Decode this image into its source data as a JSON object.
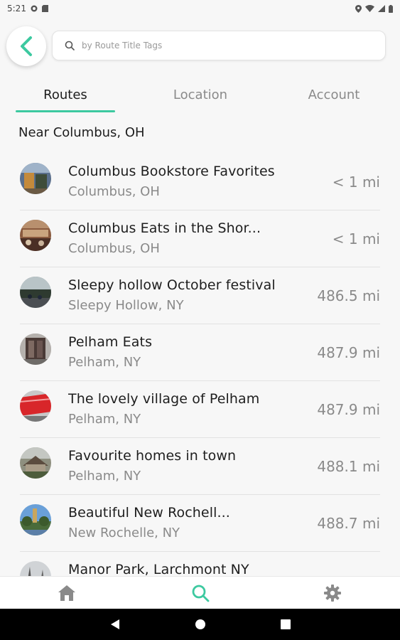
{
  "status_bar": {
    "time": "5:21"
  },
  "search": {
    "placeholder": "by Route Title Tags"
  },
  "tabs": [
    {
      "label": "Routes"
    },
    {
      "label": "Location"
    },
    {
      "label": "Account"
    }
  ],
  "section": {
    "title": "Near Columbus, OH"
  },
  "routes": [
    {
      "title": "Columbus Bookstore Favorites",
      "location": "Columbus, OH",
      "distance": "< 1 mi"
    },
    {
      "title": "Columbus Eats in the Shor...",
      "location": "Columbus, OH",
      "distance": "< 1 mi"
    },
    {
      "title": "Sleepy hollow October festival",
      "location": "Sleepy Hollow, NY",
      "distance": "486.5 mi"
    },
    {
      "title": "Pelham Eats",
      "location": "Pelham, NY",
      "distance": "487.9 mi"
    },
    {
      "title": "The lovely village of Pelham",
      "location": "Pelham, NY",
      "distance": "487.9 mi"
    },
    {
      "title": "Favourite homes in town",
      "location": "Pelham, NY",
      "distance": "488.1 mi"
    },
    {
      "title": "Beautiful New Rochell...",
      "location": "New Rochelle, NY",
      "distance": "488.7 mi"
    },
    {
      "title": "Manor Park, Larchmont NY",
      "location": "",
      "distance": ""
    }
  ],
  "colors": {
    "accent": "#3dc9a0",
    "muted_text": "#8a8a8a",
    "primary_text": "#1e1e1e"
  },
  "icons": {
    "back": "chevron-left-icon",
    "search": "search-icon",
    "nav_home": "home-icon",
    "nav_search": "search-icon",
    "nav_settings": "gear-icon"
  }
}
